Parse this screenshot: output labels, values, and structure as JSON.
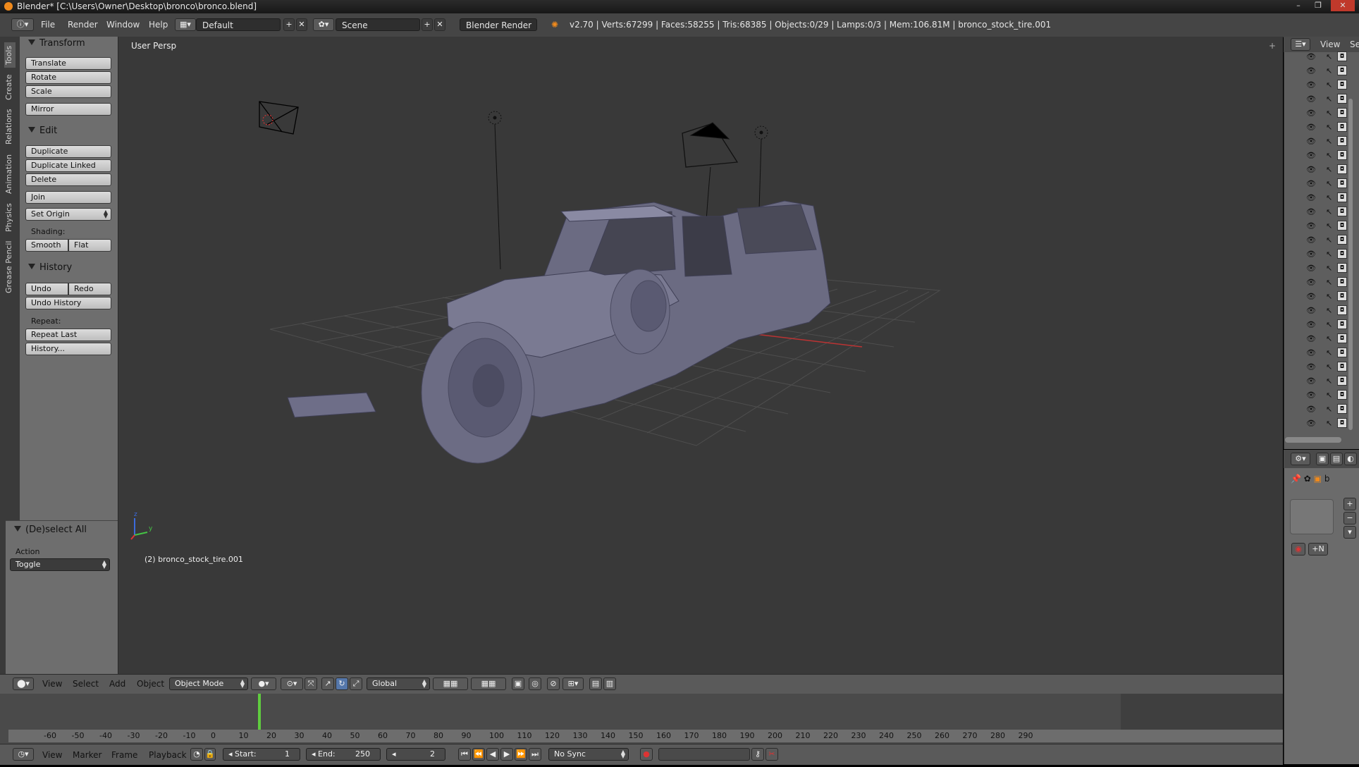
{
  "window": {
    "title": "Blender* [C:\\Users\\Owner\\Desktop\\bronco\\bronco.blend]",
    "controls": [
      "–",
      "❐",
      "✕"
    ]
  },
  "info_header": {
    "menus": [
      "File",
      "Render",
      "Window",
      "Help"
    ],
    "layout": "Default",
    "scene": "Scene",
    "engine": "Blender Render",
    "stats": "v2.70 | Verts:67299 | Faces:58255 | Tris:68385 | Objects:0/29 | Lamps:0/3 | Mem:106.81M | bronco_stock_tire.001"
  },
  "side_tabs": [
    "Tools",
    "Create",
    "Relations",
    "Animation",
    "Physics",
    "Grease Pencil"
  ],
  "tool_shelf": {
    "transform": {
      "title": "Transform",
      "buttons": [
        "Translate",
        "Rotate",
        "Scale",
        "Mirror"
      ]
    },
    "edit": {
      "title": "Edit",
      "buttons": [
        "Duplicate",
        "Duplicate Linked",
        "Delete",
        "Join"
      ],
      "set_origin": "Set Origin",
      "shading_label": "Shading:",
      "smooth": "Smooth",
      "flat": "Flat"
    },
    "history": {
      "title": "History",
      "undo": "Undo",
      "redo": "Redo",
      "undo_history": "Undo History",
      "repeat_label": "Repeat:",
      "repeat_last": "Repeat Last",
      "history": "History..."
    },
    "operator": {
      "title": "(De)select All",
      "action_label": "Action",
      "action_value": "Toggle"
    }
  },
  "viewport": {
    "view_label": "User Persp",
    "object_label": "(2) bronco_stock_tire.001",
    "axis_labels": {
      "z": "z",
      "y": "y",
      "x": "x"
    }
  },
  "view3d_header": {
    "menus": [
      "View",
      "Select",
      "Add",
      "Object"
    ],
    "mode": "Object Mode",
    "orientation": "Global"
  },
  "timeline": {
    "ticks": [
      "-60",
      "-50",
      "-40",
      "-30",
      "-20",
      "-10",
      "0",
      "10",
      "20",
      "30",
      "40",
      "50",
      "60",
      "70",
      "80",
      "90",
      "100",
      "110",
      "120",
      "130",
      "140",
      "150",
      "160",
      "170",
      "180",
      "190",
      "200",
      "210",
      "220",
      "230",
      "240",
      "250",
      "260",
      "270",
      "280",
      "290"
    ],
    "current_frame_marker": 2
  },
  "timeline_header": {
    "menus": [
      "View",
      "Marker",
      "Frame",
      "Playback"
    ],
    "start_label": "Start:",
    "start_value": "1",
    "end_label": "End:",
    "end_value": "250",
    "current": "2",
    "sync": "No Sync"
  },
  "outliner": {
    "view_label": "View",
    "search_label": "Se"
  },
  "properties": {
    "object_name": "b"
  },
  "colors": {
    "accent_orange": "#f08a1c",
    "timeline_green": "#5fcc3f",
    "viewport_bg": "#393939"
  }
}
